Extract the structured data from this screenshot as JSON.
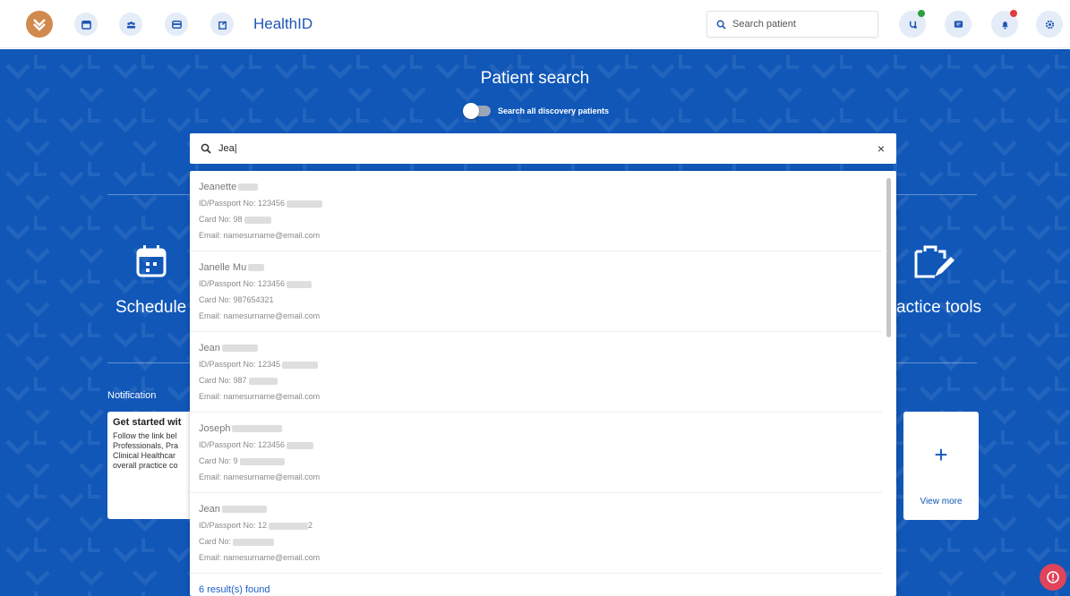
{
  "app": {
    "title": "HealthID"
  },
  "topbar": {
    "nav_icons": [
      "calendar-icon",
      "people-icon",
      "card-icon",
      "clipboard-icon"
    ],
    "search_placeholder": "Search patient",
    "right_icons": [
      "stethoscope-icon",
      "message-icon",
      "notification-icon",
      "settings-icon"
    ],
    "badge_colors": {
      "stethoscope": "#2e9e3e",
      "notification": "#e03a3a"
    }
  },
  "hero": {
    "title": "Patient search",
    "toggle_label": "Search all discovery patients",
    "toggle_on": false,
    "left_tile_label": "Schedule",
    "right_tile_label": "actice tools",
    "notification_label": "Notification",
    "notification_card": {
      "title": "Get started wit",
      "lines": [
        "Follow the link bel",
        "Professionals, Pra",
        "Clinical Healthcar",
        "overall practice co"
      ]
    },
    "view_more": {
      "plus": "+",
      "label": "View more"
    }
  },
  "search": {
    "value": "Jea|",
    "clear": "×"
  },
  "results": {
    "items": [
      {
        "name": "Jeanette",
        "id_label": "ID/Passport No: 123456",
        "card_label": "Card No: 98",
        "email": "Email: namesurname@email.com"
      },
      {
        "name": "Janelle Mu",
        "id_label": "ID/Passport No: 123456",
        "card_label": "Card No: 987654321",
        "email": "Email: namesurname@email.com"
      },
      {
        "name": "Jean",
        "id_label": "ID/Passport No: 12345",
        "card_label": "Card No: 987",
        "email": "Email: namesurname@email.com"
      },
      {
        "name": "Joseph",
        "id_label": "ID/Passport No: 123456",
        "card_label": "Card No: 9",
        "email": "Email: namesurname@email.com"
      },
      {
        "name": "Jean",
        "id_label": "ID/Passport No: 12",
        "id_suffix": "2",
        "card_label": "Card No:",
        "email": "Email: namesurname@email.com"
      }
    ],
    "found_text": "6 result(s) found"
  },
  "colors": {
    "brand_blue": "#1057b8",
    "link_blue": "#1a5fc8",
    "alert": "#e0445a"
  }
}
